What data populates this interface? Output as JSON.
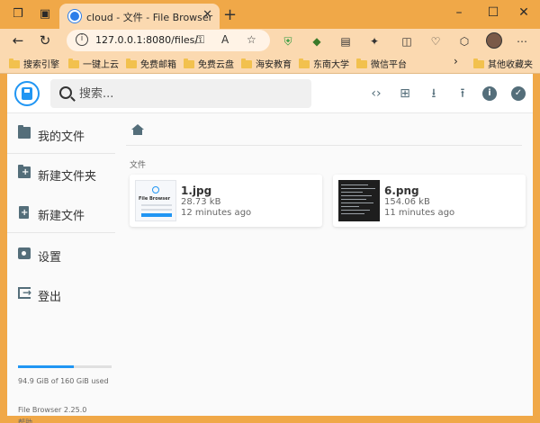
{
  "browser": {
    "tab_title": "cloud - 文件 - File Browser",
    "tab_close": "✕",
    "new_tab": "+",
    "url": "127.0.0.1:8080/files/",
    "bookmarks": [
      {
        "label": "搜索引擎"
      },
      {
        "label": "一键上云"
      },
      {
        "label": "免费邮箱"
      },
      {
        "label": "免费云盘"
      },
      {
        "label": "海安教育"
      },
      {
        "label": "东南大学"
      },
      {
        "label": "微信平台"
      },
      {
        "label": "其他收藏夹"
      }
    ],
    "more_bookmarks": "›"
  },
  "header": {
    "search_placeholder": "搜索..."
  },
  "sidebar": {
    "items": [
      {
        "label": "我的文件"
      },
      {
        "label": "新建文件夹"
      },
      {
        "label": "新建文件"
      },
      {
        "label": "设置"
      },
      {
        "label": "登出"
      }
    ],
    "usage": {
      "used_fraction": 0.593,
      "text": "94.9 GiB of 160 GiB used"
    },
    "version": "File Browser 2.25.0",
    "help": "帮助"
  },
  "content": {
    "section_label": "文件",
    "files": [
      {
        "name": "1.jpg",
        "size": "28.73 kB",
        "modified": "12 minutes ago",
        "thumb_caption": "File Browser"
      },
      {
        "name": "6.png",
        "size": "154.06 kB",
        "modified": "11 minutes ago"
      }
    ]
  },
  "colors": {
    "brand": "#2196f3",
    "icon": "#546e7a",
    "browser_frame": "#f0a848"
  }
}
